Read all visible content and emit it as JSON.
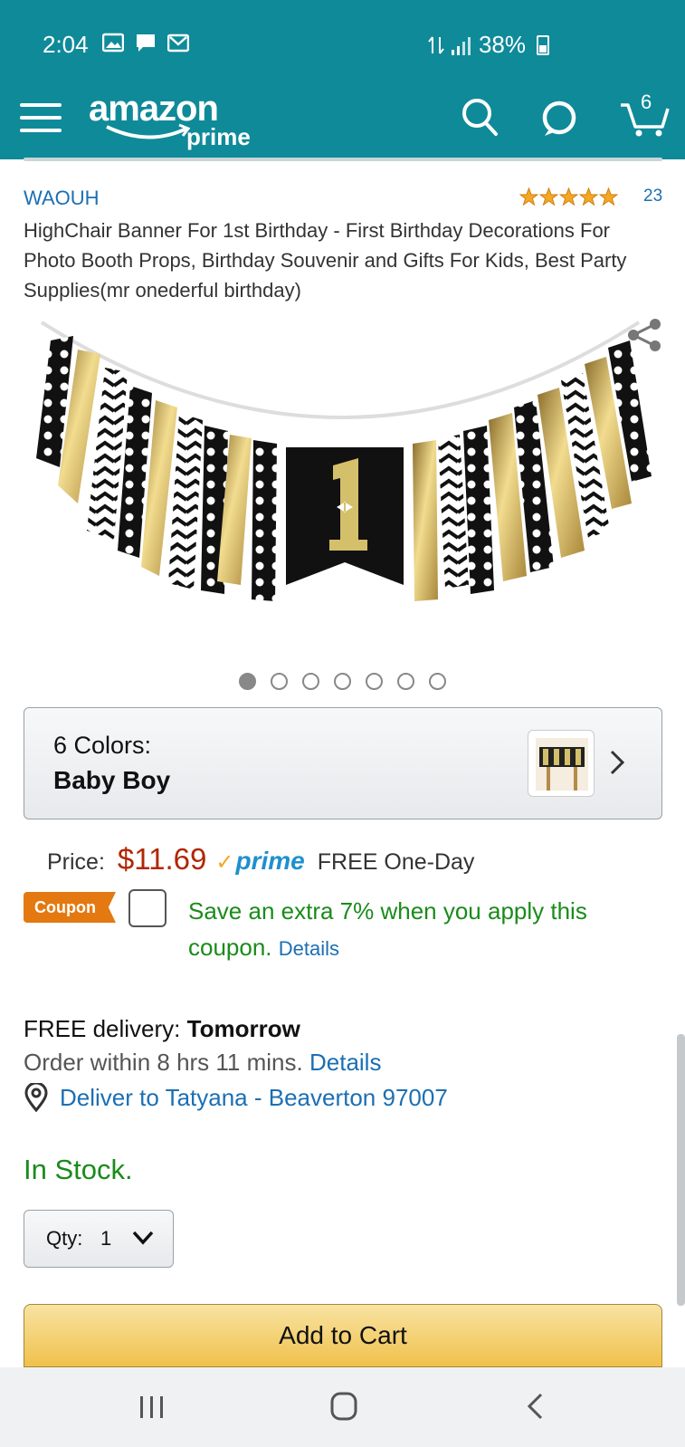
{
  "status_bar": {
    "time": "2:04",
    "battery": "38%"
  },
  "header": {
    "logo_word": "amazon",
    "logo_sub": "prime",
    "cart_count": "6"
  },
  "product": {
    "brand": "WAOUH",
    "rating_stars": 5,
    "rating_count": "23",
    "title": "HighChair Banner For 1st Birthday - First Birthday Decorations For Photo Booth Props, Birthday Souvenir and Gifts For Kids, Best Party Supplies(mr onederful birthday)",
    "image_count": 7,
    "active_image": 0
  },
  "variation": {
    "label": "6 Colors:",
    "value": "Baby Boy"
  },
  "pricing": {
    "price_label": "Price:",
    "price": "$11.69",
    "prime_label": "prime",
    "shipping": "FREE One-Day",
    "coupon_tag": "Coupon",
    "coupon_text": "Save an extra 7% when you apply this coupon.",
    "coupon_details": "Details"
  },
  "delivery": {
    "free_prefix": "FREE delivery:",
    "day": "Tomorrow",
    "order_within": "Order within 8 hrs 11 mins.",
    "order_details": "Details",
    "deliver_to": "Deliver to Tatyana - Beaverton 97007"
  },
  "stock": "In Stock.",
  "quantity": {
    "label": "Qty:",
    "value": "1"
  },
  "add_to_cart": "Add to Cart",
  "colors": {
    "teal": "#0f8a99",
    "link": "#1b6fb3",
    "price": "#b12704",
    "green": "#1a8b1a",
    "coupon": "#e47911",
    "star": "#f5a623"
  }
}
